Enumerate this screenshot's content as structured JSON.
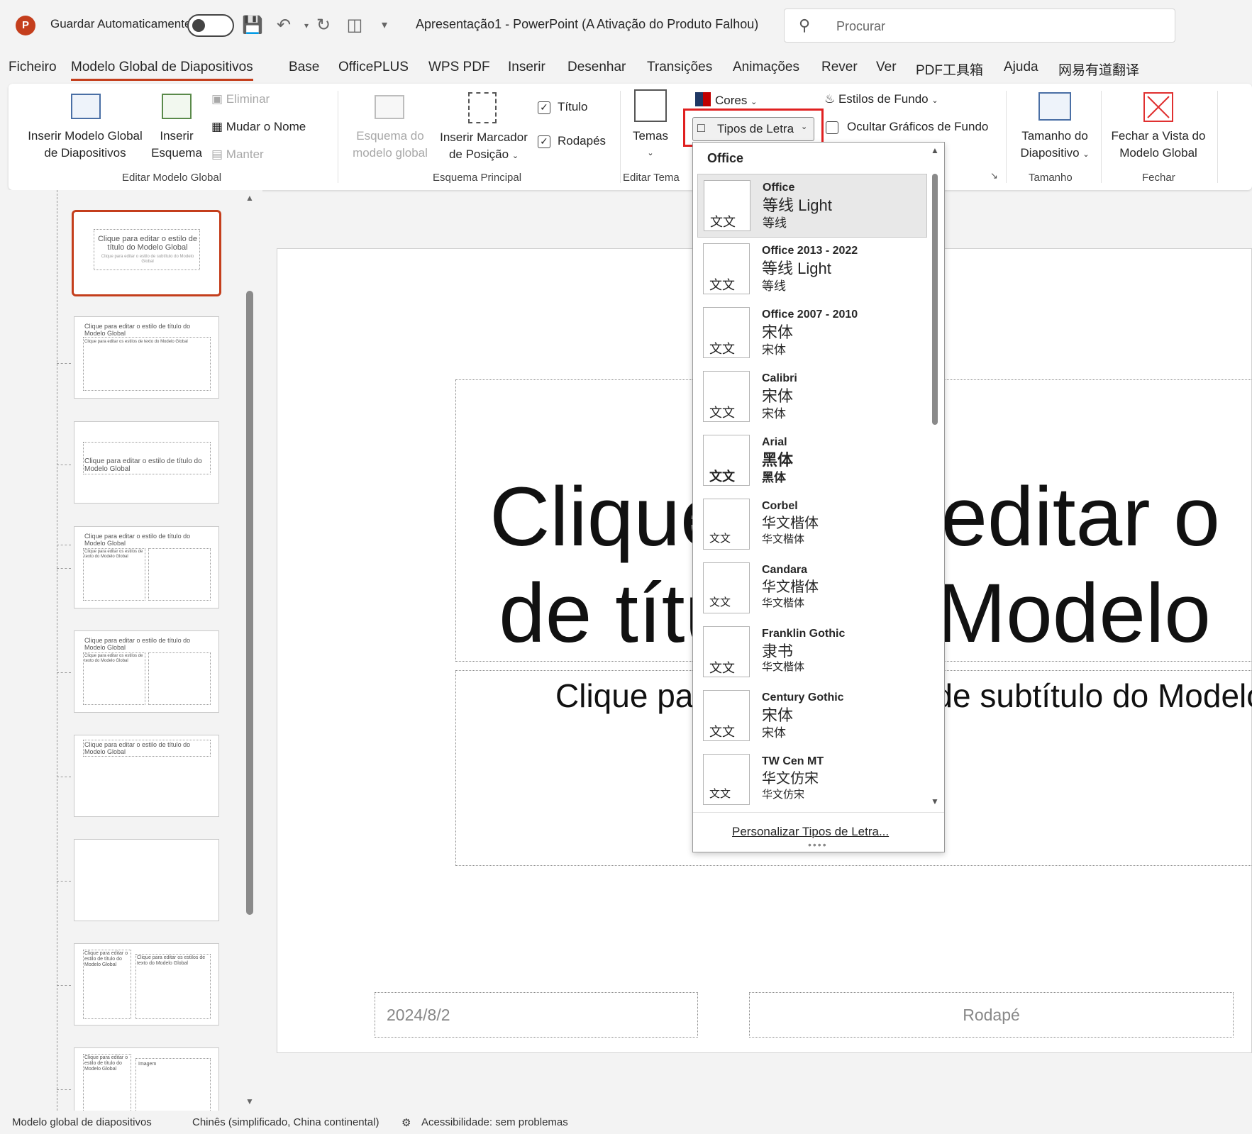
{
  "app": {
    "logo": "P",
    "autosave_label": "Guardar Automaticamente",
    "autosave_on": false,
    "doc_title": "Apresentação1  -  PowerPoint (A Ativação do Produto Falhou)",
    "search_placeholder": "Procurar",
    "accent_color": "#c43e1c"
  },
  "tabs": [
    {
      "label": "Ficheiro"
    },
    {
      "label": "Modelo Global de Diapositivos",
      "active": true
    },
    {
      "label": "Base"
    },
    {
      "label": "OfficePLUS"
    },
    {
      "label": "WPS PDF"
    },
    {
      "label": "Inserir"
    },
    {
      "label": "Desenhar"
    },
    {
      "label": "Transições"
    },
    {
      "label": "Animações"
    },
    {
      "label": "Rever"
    },
    {
      "label": "Ver"
    },
    {
      "label": "PDF工具箱"
    },
    {
      "label": "Ajuda"
    },
    {
      "label": "网易有道翻译"
    }
  ],
  "ribbon": {
    "insert_master_line1": "Inserir Modelo Global",
    "insert_master_line2": "de Diapositivos",
    "insert_layout_line1": "Inserir",
    "insert_layout_line2": "Esquema",
    "delete": "Eliminar",
    "rename": "Mudar o Nome",
    "keep": "Manter",
    "group_edit_master": "Editar Modelo Global",
    "master_layout_line1": "Esquema do",
    "master_layout_line2": "modelo global",
    "insert_placeholder_line1": "Inserir Marcador",
    "insert_placeholder_line2": "de Posição",
    "title_check": "Título",
    "footers_check": "Rodapés",
    "title_checked": true,
    "footers_checked": true,
    "group_master_layout": "Esquema Principal",
    "themes": "Temas",
    "group_edit_theme": "Editar Tema",
    "colors": "Cores",
    "fonts": "Tipos de Letra",
    "bg_styles": "Estilos de Fundo",
    "hide_bg": "Ocultar Gráficos de Fundo",
    "hide_bg_checked": false,
    "slide_size_line1": "Tamanho do",
    "slide_size_line2": "Diapositivo",
    "group_size": "Tamanho",
    "close_master_line1": "Fechar a Vista do",
    "close_master_line2": "Modelo Global",
    "group_close": "Fechar"
  },
  "thumbnails": [
    {
      "title": "Clique para editar o estilo de título do Modelo Global",
      "sub": "Clique para editar o estilo de subtítulo do Modelo Global"
    },
    {
      "title": "Clique para editar o estilo de título do Modelo Global",
      "sub": "Clique para editar os estilos de texto do Modelo Global"
    },
    {
      "title": "Clique para editar o estilo de título do Modelo Global",
      "sub": ""
    },
    {
      "title": "Clique para editar o estilo de título do Modelo Global",
      "sub": "Clique para editar os estilos de texto do Modelo Global"
    },
    {
      "title": "Clique para editar o estilo de título do Modelo Global",
      "sub": "Clique para editar os estilos de texto do Modelo Global"
    },
    {
      "title": "Clique para editar o estilo de título do Modelo Global",
      "sub": ""
    },
    {
      "title": "",
      "sub": ""
    },
    {
      "title": "Clique para editar o estilo de título do Modelo Global",
      "sub": "Clique para editar os estilos de texto do Modelo Global"
    },
    {
      "title": "Clique para editar o estilo de título do Modelo Global",
      "sub": "Imagem"
    }
  ],
  "slide": {
    "title": "Clique para editar o estilo de título do Modelo Global",
    "title_visible_line1": "Clique para editar o",
    "title_visible_line2": "de título do Modelo",
    "subtitle": "Clique para editar o estilo de subtítulo do Modelo Global",
    "date": "2024/8/2",
    "footer": "Rodapé"
  },
  "font_dropdown": {
    "header": "Office",
    "preview_glyph": "文文",
    "items": [
      {
        "name": "Office",
        "heading": "等线 Light",
        "body": "等线",
        "highlighted": true
      },
      {
        "name": "Office 2013 - 2022",
        "heading": "等线 Light",
        "body": "等线"
      },
      {
        "name": "Office 2007 - 2010",
        "heading": "宋体",
        "body": "宋体"
      },
      {
        "name": "Calibri",
        "heading": "宋体",
        "body": "宋体"
      },
      {
        "name": "Arial",
        "heading": "黑体",
        "body": "黑体"
      },
      {
        "name": "Corbel",
        "heading": "华文楷体",
        "body": "华文楷体"
      },
      {
        "name": "Candara",
        "heading": "华文楷体",
        "body": "华文楷体"
      },
      {
        "name": "Franklin Gothic",
        "heading": "隶书",
        "body": "华文楷体"
      },
      {
        "name": "Century Gothic",
        "heading": "宋体",
        "body": "宋体"
      },
      {
        "name": "TW Cen MT",
        "heading": "华文仿宋",
        "body": "华文仿宋"
      }
    ],
    "customize": "Personalizar Tipos de Letra..."
  },
  "status": {
    "view": "Modelo global de diapositivos",
    "language": "Chinês (simplificado, China continental)",
    "accessibility": "Acessibilidade: sem problemas"
  }
}
